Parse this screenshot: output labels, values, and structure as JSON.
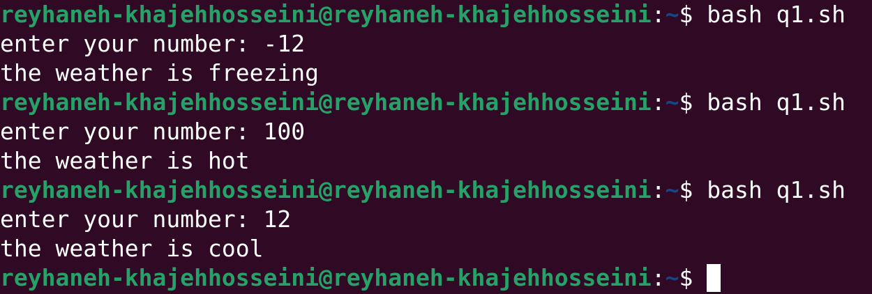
{
  "prompt": {
    "user_host": "reyhaneh-khajehhosseini@reyhaneh-khajehhosseini",
    "colon": ":",
    "cwd": "~",
    "symbol": "$ "
  },
  "sessions": [
    {
      "command": "bash q1.sh",
      "input_line": "enter your number: -12",
      "output_line": "the weather is freezing"
    },
    {
      "command": "bash q1.sh",
      "input_line": "enter your number: 100",
      "output_line": "the weather is hot"
    },
    {
      "command": "bash q1.sh",
      "input_line": "enter your number: 12",
      "output_line": "the weather is cool"
    }
  ],
  "colors": {
    "background": "#300a24",
    "user_host": "#26a269",
    "cwd": "#12488b",
    "text": "#ffffff"
  }
}
